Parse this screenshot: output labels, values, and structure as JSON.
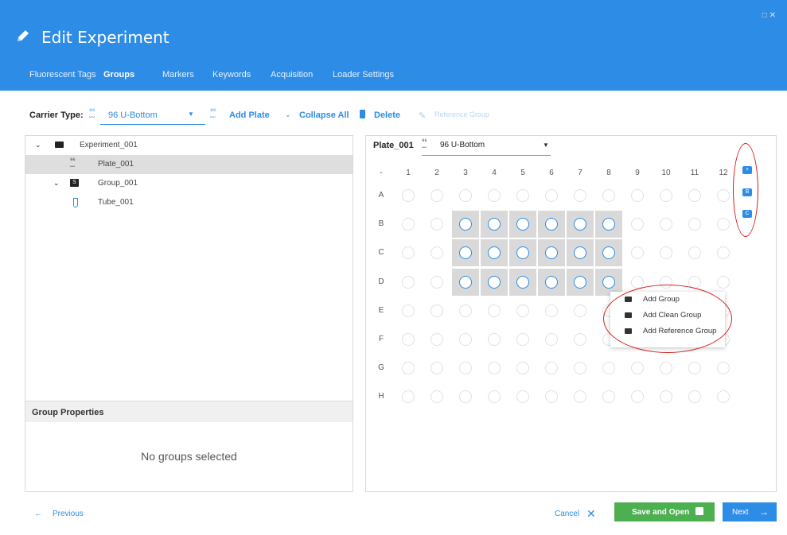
{
  "window": {
    "controls": "□  ✕"
  },
  "header": {
    "title": "Edit Experiment"
  },
  "tabs": [
    {
      "label": "Fluorescent Tags"
    },
    {
      "label": "Groups"
    },
    {
      "label": "Markers"
    },
    {
      "label": "Keywords"
    },
    {
      "label": "Acquisition"
    },
    {
      "label": "Loader Settings"
    }
  ],
  "toolbar": {
    "carrier_label": "Carrier Type:",
    "carrier_value": "96 U-Bottom",
    "add_plate": "Add Plate",
    "collapse_all": "Collapse All",
    "delete": "Delete",
    "reference_group": "Reference Group"
  },
  "tree": {
    "experiment": "Experiment_001",
    "plate": "Plate_001",
    "group": "Group_001",
    "tube": "Tube_001"
  },
  "group_properties": {
    "title": "Group Properties",
    "empty_text": "No groups selected"
  },
  "plate": {
    "name": "Plate_001",
    "type": "96 U-Bottom",
    "corner": "-",
    "columns": [
      "1",
      "2",
      "3",
      "4",
      "5",
      "6",
      "7",
      "8",
      "9",
      "10",
      "11",
      "12"
    ],
    "rows": [
      "A",
      "B",
      "C",
      "D",
      "E",
      "F",
      "G",
      "H"
    ],
    "selected_rows": [
      "B",
      "C",
      "D"
    ],
    "selected_cols": [
      "3",
      "4",
      "5",
      "6",
      "7",
      "8"
    ]
  },
  "side_icons": [
    "add-group-icon",
    "group-b-icon",
    "group-c-icon"
  ],
  "context_menu": {
    "items": [
      "Add Group",
      "Add Clean Group",
      "Add Reference Group"
    ]
  },
  "footer": {
    "previous": "Previous",
    "cancel": "Cancel",
    "save_and_open": "Save and Open",
    "next": "Next"
  },
  "colors": {
    "accent": "#2d8ce6",
    "green": "#4caf50",
    "annotation": "#d21e1e"
  }
}
